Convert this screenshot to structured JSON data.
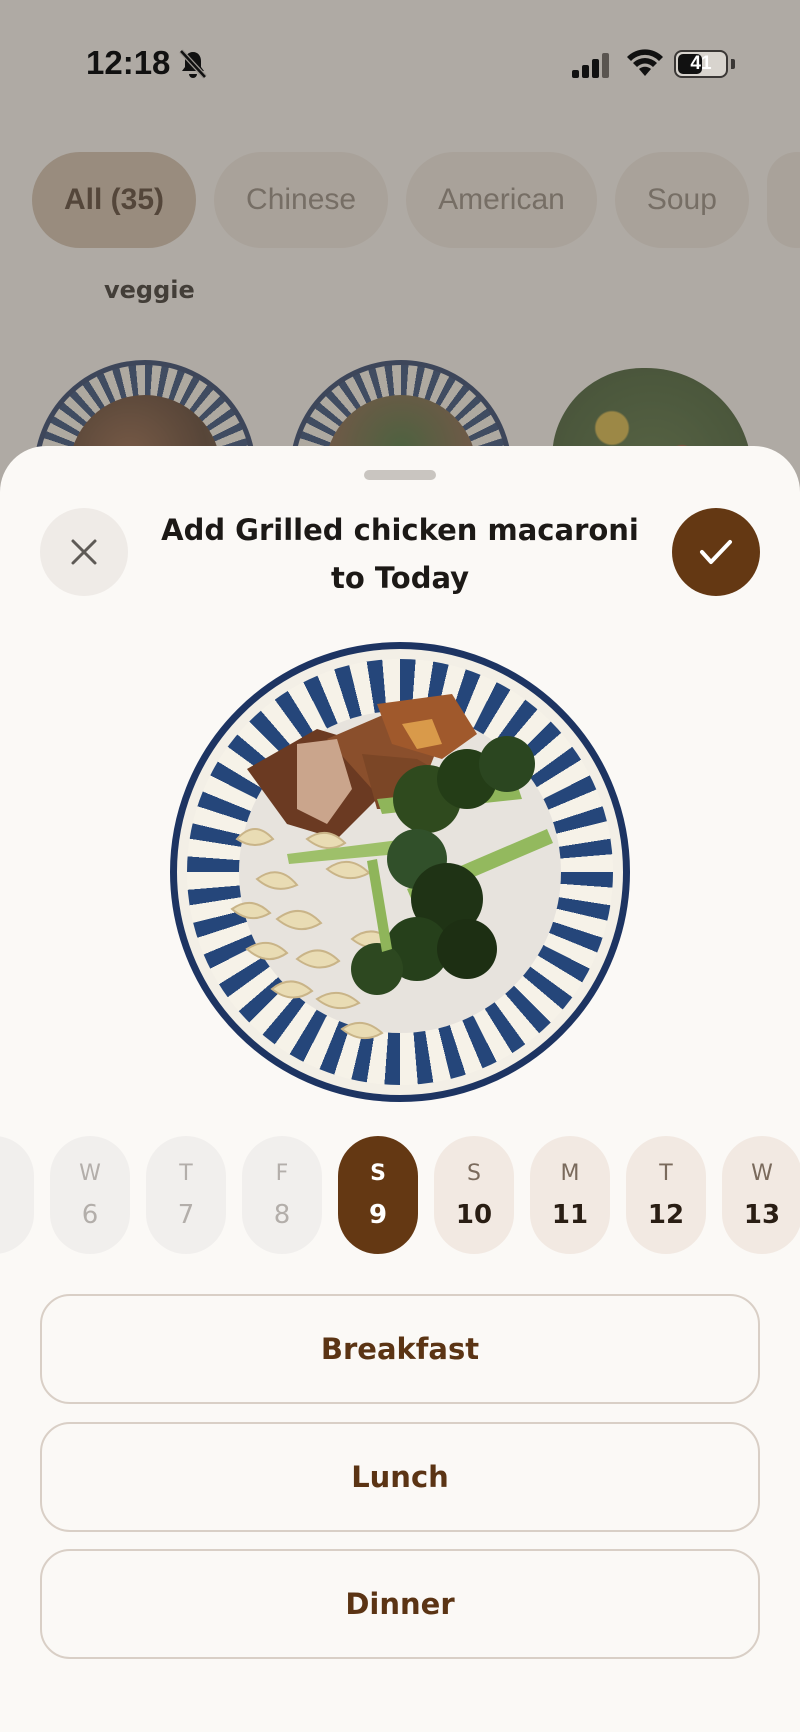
{
  "status_bar": {
    "time": "12:18",
    "battery": "41"
  },
  "categories": [
    "All (35)",
    "Chinese",
    "American",
    "Soup"
  ],
  "collection_label": "veggie",
  "sheet": {
    "title_line1": "Add Grilled chicken macaroni",
    "title_line2": "to Today",
    "close_icon": "close-icon",
    "confirm_icon": "checkmark-icon",
    "accent_color": "#643813"
  },
  "days": [
    {
      "dow": "W",
      "num": "6",
      "state": "past"
    },
    {
      "dow": "T",
      "num": "7",
      "state": "past"
    },
    {
      "dow": "F",
      "num": "8",
      "state": "past"
    },
    {
      "dow": "S",
      "num": "9",
      "state": "selected"
    },
    {
      "dow": "S",
      "num": "10",
      "state": "upcoming"
    },
    {
      "dow": "M",
      "num": "11",
      "state": "upcoming"
    },
    {
      "dow": "T",
      "num": "12",
      "state": "upcoming"
    },
    {
      "dow": "W",
      "num": "13",
      "state": "upcoming"
    }
  ],
  "meals": {
    "breakfast": "Breakfast",
    "lunch": "Lunch",
    "dinner": "Dinner"
  }
}
